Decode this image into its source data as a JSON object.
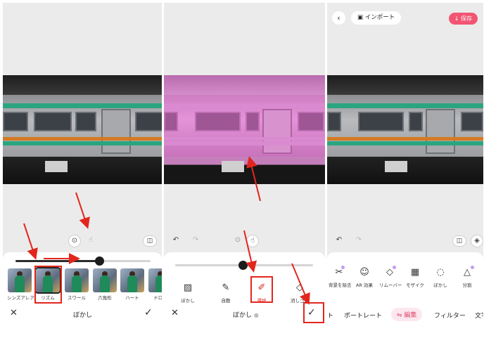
{
  "panel1": {
    "title": "ぼかし",
    "effects": [
      {
        "label": "シンズアレア"
      },
      {
        "label": "リズム"
      },
      {
        "label": "スワール"
      },
      {
        "label": "六角形"
      },
      {
        "label": "ハート"
      },
      {
        "label": "ドロッ"
      }
    ],
    "slider_value": 0.62
  },
  "panel2": {
    "title": "ぼかし",
    "tools": [
      {
        "label": "ぼかし"
      },
      {
        "label": "自動"
      },
      {
        "label": "選択"
      },
      {
        "label": "消しゴム"
      }
    ],
    "slider_value": 0.49
  },
  "panel3": {
    "import_label": "インポート",
    "save_label": "保存",
    "tools": [
      {
        "label": "背景を除去"
      },
      {
        "label": "AR 効果"
      },
      {
        "label": "リムーバー"
      },
      {
        "label": "モザイク"
      },
      {
        "label": "ぼかし"
      },
      {
        "label": "分割"
      }
    ],
    "tabs": [
      {
        "label": "ト"
      },
      {
        "label": "ポートレート"
      },
      {
        "label": "編集"
      },
      {
        "label": "フィルター"
      },
      {
        "label": "文字"
      }
    ]
  },
  "colors": {
    "highlight": "#e2261d",
    "save_button": "#f25573",
    "active_tab": "#e04a6d"
  }
}
